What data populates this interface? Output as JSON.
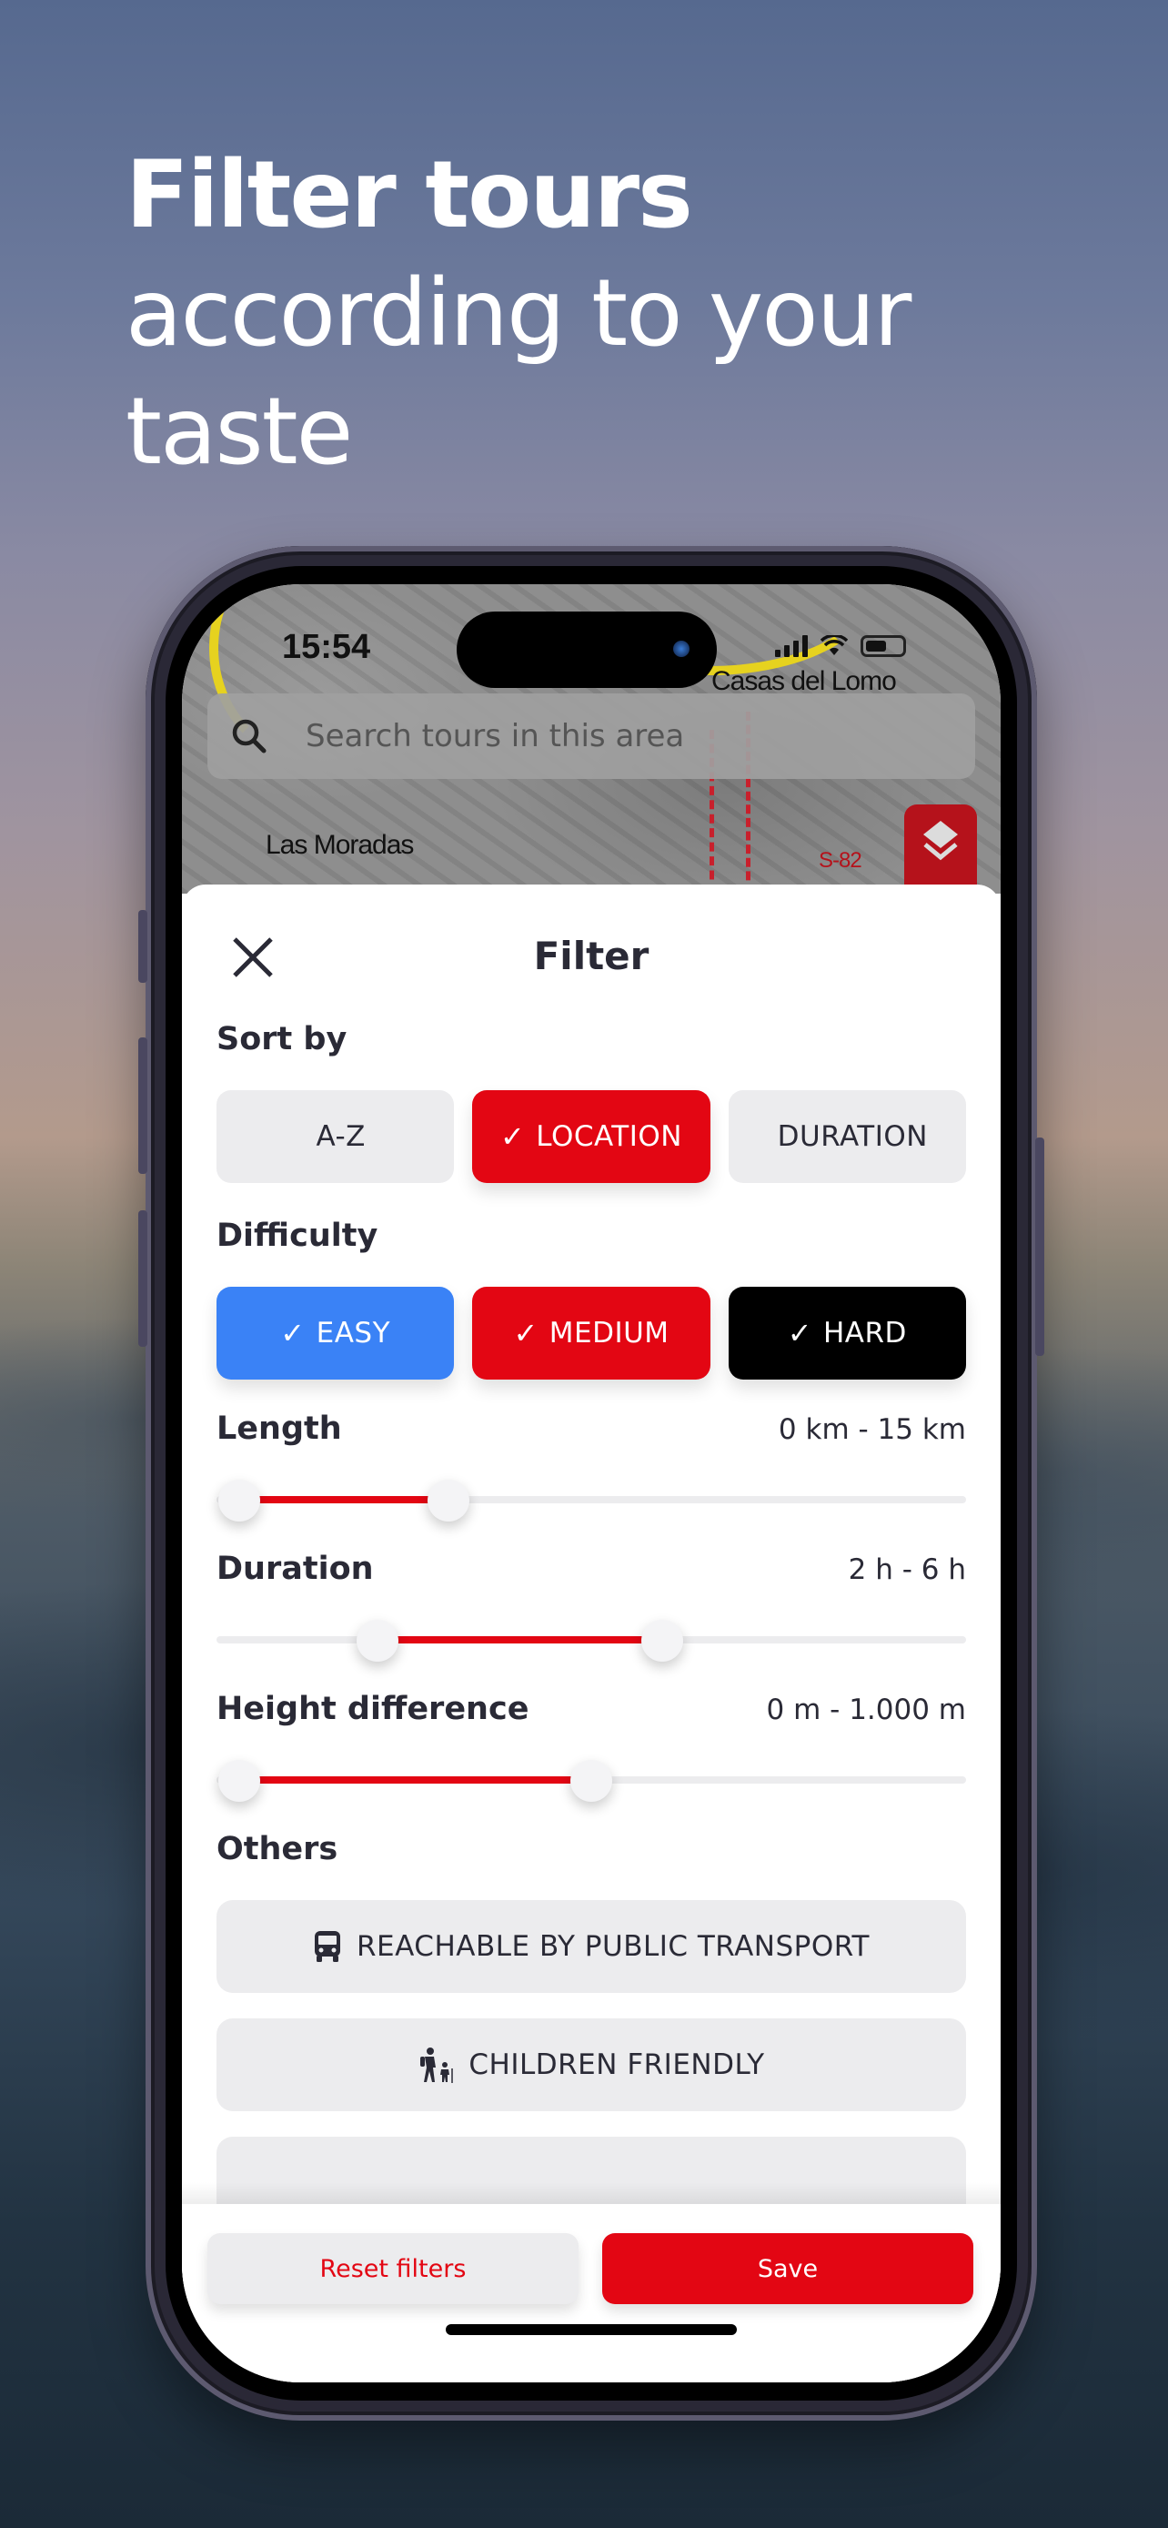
{
  "headline": {
    "bold": "Filter tours",
    "line2": "according to your",
    "line3": "taste"
  },
  "status_bar": {
    "time": "15:54",
    "icons": [
      "signal-icon",
      "wifi-icon",
      "battery-icon"
    ]
  },
  "map": {
    "labels": [
      "Casas del Lomo",
      "Las Moradas",
      "S-82"
    ],
    "search_placeholder": "Search tours in this area",
    "layers_button_icon": "layers-icon"
  },
  "filter_sheet": {
    "title": "Filter",
    "close_icon": "close-icon",
    "sort_by": {
      "label": "Sort by",
      "options": [
        {
          "label": "A-Z",
          "selected": false
        },
        {
          "label": "LOCATION",
          "selected": true
        },
        {
          "label": "DURATION",
          "selected": false
        }
      ]
    },
    "difficulty": {
      "label": "Difficulty",
      "options": [
        {
          "label": "EASY",
          "selected": true,
          "color": "#3a82f6"
        },
        {
          "label": "MEDIUM",
          "selected": true,
          "color": "#e30613"
        },
        {
          "label": "HARD",
          "selected": true,
          "color": "#000000"
        }
      ]
    },
    "ranges": [
      {
        "label": "Length",
        "value_text": "0 km - 15 km",
        "low": 0.03,
        "high": 0.31
      },
      {
        "label": "Duration",
        "value_text": "2 h - 6 h",
        "low": 0.215,
        "high": 0.595
      },
      {
        "label": "Height difference",
        "value_text": "0 m - 1.000 m",
        "low": 0.03,
        "high": 0.5
      }
    ],
    "others": {
      "label": "Others",
      "options": [
        {
          "label": "REACHABLE BY PUBLIC TRANSPORT",
          "icon": "bus-icon"
        },
        {
          "label": "CHILDREN FRIENDLY",
          "icon": "family-hiking-icon"
        },
        {
          "label": "",
          "icon": "partially-hidden-icon"
        }
      ]
    },
    "footer": {
      "reset_label": "Reset filters",
      "save_label": "Save"
    }
  },
  "colors": {
    "accent_red": "#e30613",
    "easy_blue": "#3a82f6",
    "hard_black": "#000000",
    "chip_gray": "#ececee",
    "text_dark": "#2a2a36"
  }
}
